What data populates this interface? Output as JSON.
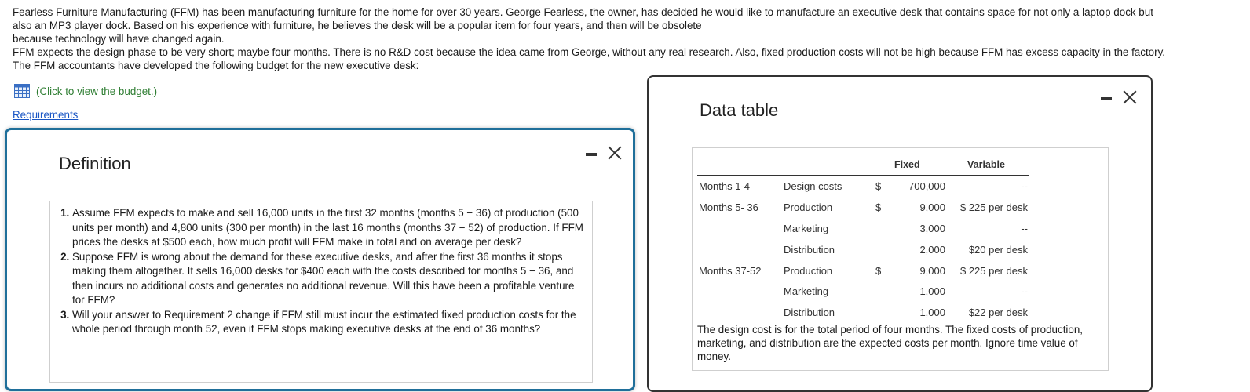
{
  "intro": {
    "line1": "Fearless Furniture Manufacturing (FFM) has been manufacturing furniture for the home for over 30 years. George Fearless, the owner, has decided he would like to manufacture an executive desk that contains space for not only a laptop dock but",
    "line2": "also an MP3 player dock. Based on his experience with furniture, he believes the desk will be a popular item for four years, and then will be obsolete",
    "line3": "because technology will have changed again.",
    "line4": "FFM expects the design phase to be very short; maybe four months. There is no R&D cost because the idea came from George, without any real research. Also, fixed production costs will not be high because FFM has excess capacity in the factory.",
    "line5": "The FFM accountants have developed the following budget for the new executive desk:"
  },
  "budget_link": {
    "label": "(Click to view the budget.)",
    "icon": "table-grid-icon",
    "color": "#2e7d32"
  },
  "requirements_link": {
    "label": "Requirements",
    "color": "#1a56c4"
  },
  "definition_window": {
    "title": "Definition",
    "border_color": "#1f6f9a",
    "items": [
      "Assume FFM expects to make and sell 16,000 units in the first 32 months (months 5 − 36) of production (500 units per month) and 4,800 units (300 per month) in the last 16 months (months 37 − 52) of production. If FFM prices the desks at $500 each, how much profit will FFM make in total and on average per desk?",
      "Suppose FFM is wrong about the demand for these executive desks, and after the first 36 months it stops making them altogether. It sells 16,000 desks for $400 each with the costs described for months 5 − 36, and then incurs no additional costs and generates no additional revenue. Will this have been a profitable venture for FFM?",
      "Will your answer to Requirement 2 change if FFM still must incur the estimated fixed production costs for the whole period through month 52, even if FFM stops making executive desks at the end of 36 months?"
    ]
  },
  "data_table_window": {
    "title": "Data table",
    "headers": {
      "fixed": "Fixed",
      "variable": "Variable"
    },
    "rows": [
      {
        "period": "Months 1-4",
        "item": "Design costs",
        "dollar": "$",
        "fixed": "700,000",
        "variable": "--"
      },
      {
        "period": "Months 5- 36",
        "item": "Production",
        "dollar": "$",
        "fixed": "9,000",
        "variable": "$ 225 per desk"
      },
      {
        "period": "",
        "item": "Marketing",
        "dollar": "",
        "fixed": "3,000",
        "variable": "--"
      },
      {
        "period": "",
        "item": "Distribution",
        "dollar": "",
        "fixed": "2,000",
        "variable": "$20 per desk"
      },
      {
        "period": "Months 37-52",
        "item": "Production",
        "dollar": "$",
        "fixed": "9,000",
        "variable": "$ 225 per desk"
      },
      {
        "period": "",
        "item": "Marketing",
        "dollar": "",
        "fixed": "1,000",
        "variable": "--"
      },
      {
        "period": "",
        "item": "Distribution",
        "dollar": "",
        "fixed": "1,000",
        "variable": "$22 per desk"
      }
    ],
    "note": "The design cost is for the total period of four months. The fixed costs of production, marketing, and distribution are the expected costs per month. Ignore time value of money."
  }
}
